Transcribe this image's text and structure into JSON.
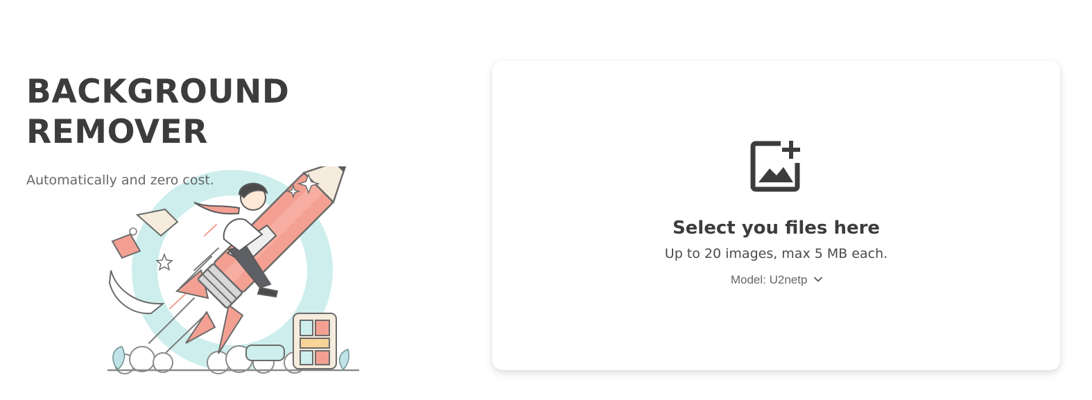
{
  "hero": {
    "title_line1": "BACKGROUND",
    "title_line2": "REMOVER",
    "subtitle": "Automatically and zero cost."
  },
  "upload": {
    "icon": "add-image-icon",
    "title": "Select you files here",
    "hint": "Up to 20 images, max 5 MB each.",
    "model_label": "Model:",
    "model_value": "U2netp"
  },
  "colors": {
    "heading": "#3c3c3c",
    "muted": "#666666",
    "illustration_pink": "#f3a093",
    "illustration_teal": "#cdeeed"
  }
}
